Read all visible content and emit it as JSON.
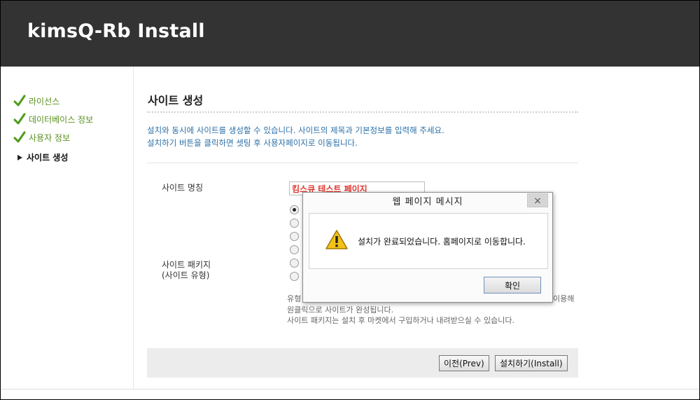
{
  "header": {
    "title": "kimsQ-Rb Install"
  },
  "sidebar": {
    "steps": [
      {
        "label": "라이선스",
        "state": "done"
      },
      {
        "label": "데이터베이스 정보",
        "state": "done"
      },
      {
        "label": "사용자 정보",
        "state": "done"
      },
      {
        "label": "사이트 생성",
        "state": "active"
      }
    ]
  },
  "main": {
    "title": "사이트 생성",
    "intro_line1": "설치와 동시에 사이트를 생성할 수 있습니다. 사이트의 제목과 기본정보를 입력해 주세요.",
    "intro_line2": "설치하기 버튼을 클릭하면 셋팅 후 사용자페이지로 이동됩니다.",
    "site_name_label": "사이트 명칭",
    "site_name_value": "킴스큐 테스트 페이지",
    "package_label_line1": "사이트 패키지",
    "package_label_line2": "(사이트 유형)",
    "desc_line1_start": "유형",
    "desc_line1_end": "이용해",
    "desc_line2": "원클릭으로 사이트가 완성됩니다.",
    "desc_line3": "사이트 패키지는 설치 후 마켓에서 구입하거나 내려받으실 수 있습니다.",
    "prev_button": "이전(Prev)",
    "install_button": "설치하기(Install)"
  },
  "dialog": {
    "title": "웹 페이지 메시지",
    "close_label": "×",
    "message": "설치가 완료되었습니다. 홈페이지로 이동합니다.",
    "ok_button": "확인"
  },
  "colors": {
    "header_bg": "#333333",
    "done_green": "#5a8f1f",
    "intro_blue": "#2a6fa8",
    "site_name_red": "#e0362e"
  }
}
